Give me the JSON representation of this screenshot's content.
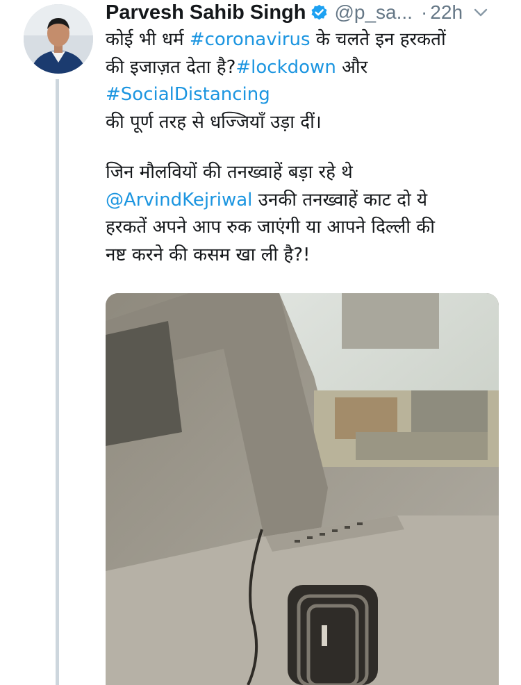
{
  "author": {
    "name": "Parvesh Sahib Singh",
    "handle": "@p_sa...",
    "separator": "·",
    "time": "22h",
    "verified_icon": "verified-badge-icon",
    "menu_icon": "chevron-down-icon"
  },
  "tweet": {
    "line1_a": "कोई भी धर्म ",
    "line1_tag": "#coronavirus",
    "line1_b": " के चलते इन हरकतों",
    "line2_a": "की इजाज़त देता है?",
    "line2_tag": "#lockdown",
    "line2_b": " और",
    "line3_tag": "#SocialDistancing",
    "line4": "की पूर्ण तरह से धज्जियाँ उड़ा दीं।",
    "line5": "जिन मौलवियों की तनख्वाहें बड़ा रहे थे",
    "line6_mention": "@ArvindKejriwal",
    "line6_b": " उनकी तनख्वाहें काट दो ये",
    "line7": "हरकतें अपने आप रुक जाएंगी या आपने दिल्ली की",
    "line8": "नष्ट करने की कसम खा ली है?!"
  },
  "colors": {
    "link": "#1b95e0",
    "verified": "#1da1f2",
    "meta": "#657786",
    "thread_line": "#cdd6dd"
  }
}
